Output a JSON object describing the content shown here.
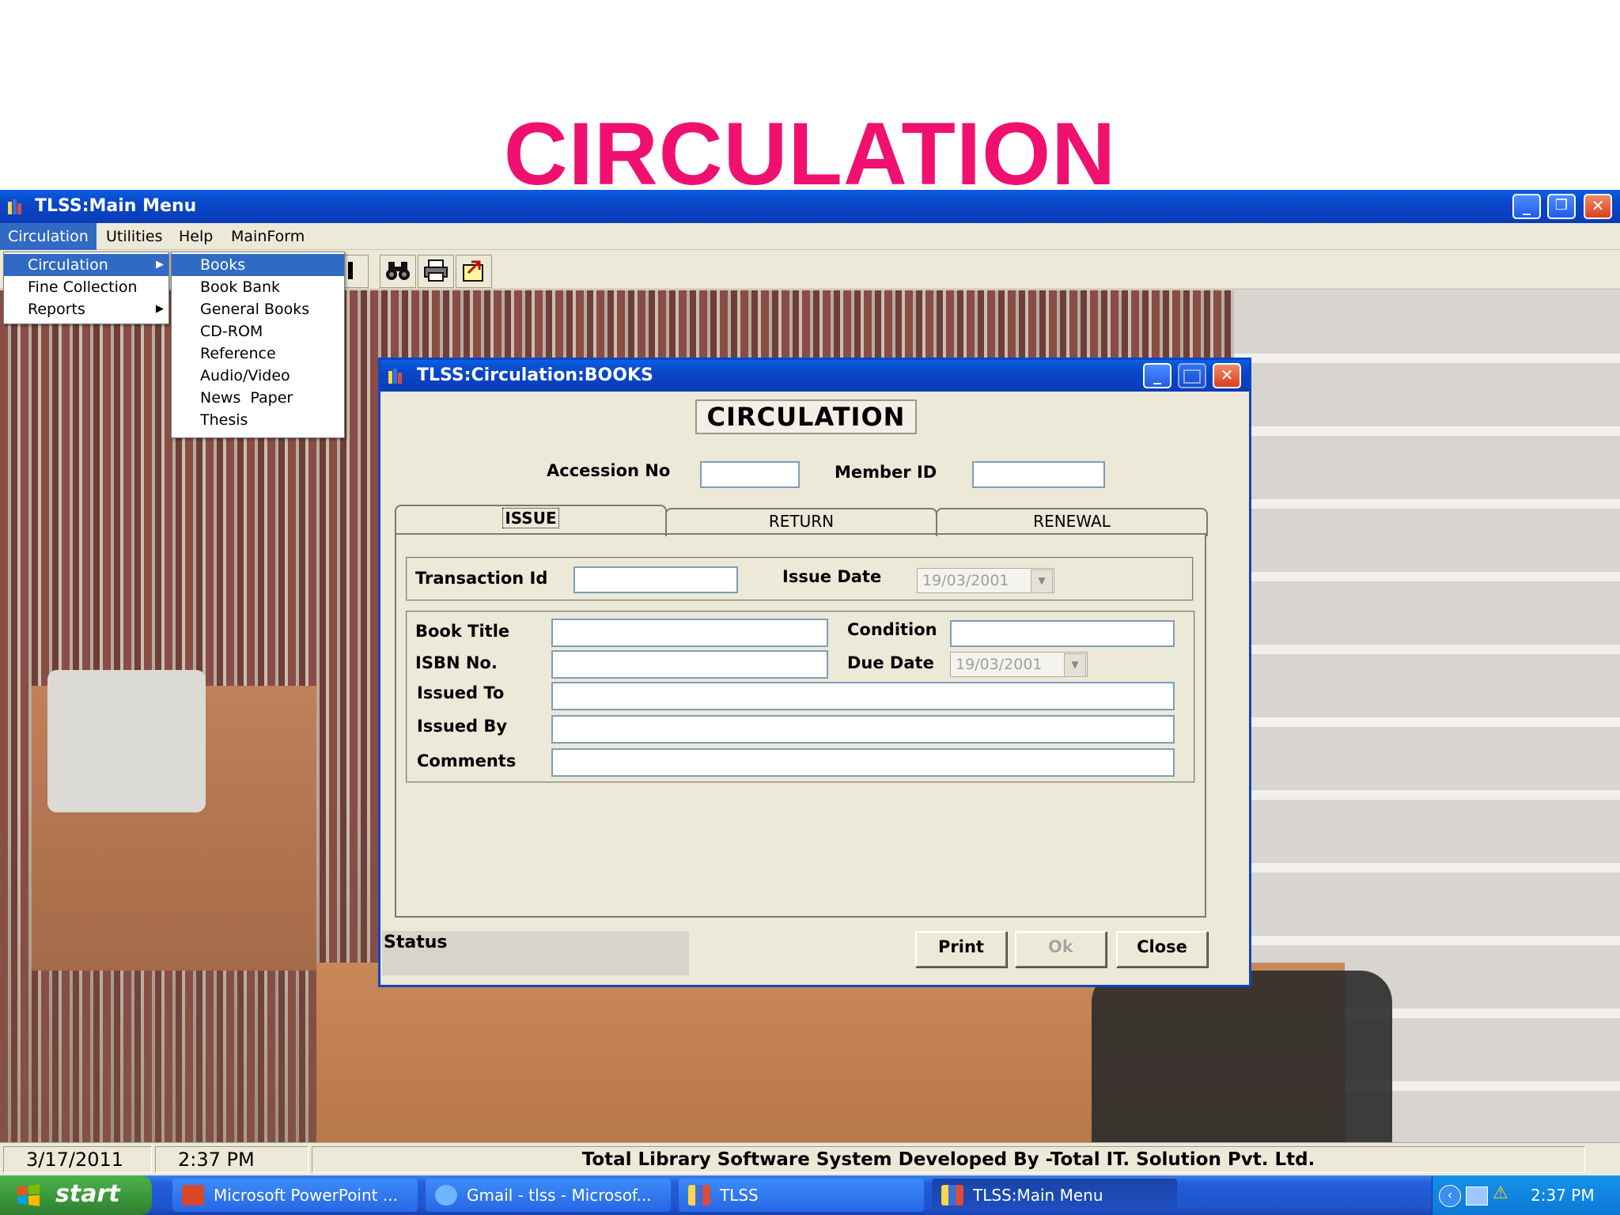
{
  "slide": {
    "title": "CIRCULATION"
  },
  "main_window": {
    "title": "TLSS:Main Menu",
    "controls": {
      "minimize": "_",
      "maximize": "❐",
      "close": "✕"
    }
  },
  "menubar": {
    "items": [
      "Circulation",
      "Utilities",
      "Help",
      "MainForm"
    ]
  },
  "circulation_menu": {
    "items": [
      "Circulation",
      "Fine Collection",
      "Reports"
    ],
    "submenu_marker": "▶"
  },
  "books_submenu": {
    "items": [
      "Books",
      "Book Bank",
      "General Books",
      "CD-ROM",
      "Reference",
      "Audio/Video",
      "News  Paper",
      "Thesis"
    ]
  },
  "toolbar": {
    "icons": [
      "binoculars-icon",
      "printer-icon",
      "export-icon"
    ]
  },
  "child_window": {
    "title": "TLSS:Circulation:BOOKS",
    "heading": "CIRCULATION",
    "accession_label": "Accession No",
    "accession_value": "",
    "member_label": "Member ID",
    "member_value": "",
    "tabs": [
      "ISSUE",
      "RETURN",
      "RENEWAL"
    ],
    "active_tab": "ISSUE",
    "issue": {
      "transaction_label": "Transaction Id",
      "transaction_value": "",
      "issue_date_label": "Issue Date",
      "issue_date_value": "19/03/2001",
      "book_title_label": "Book Title",
      "condition_label": "Condition",
      "isbn_label": "ISBN No.",
      "due_date_label": "Due Date",
      "due_date_value": "19/03/2001",
      "issued_to_label": "Issued To",
      "issued_by_label": "Issued By",
      "comments_label": "Comments"
    },
    "status_label": "Status",
    "buttons": {
      "print": "Print",
      "ok": "Ok",
      "close": "Close"
    }
  },
  "statusbar": {
    "date": "3/17/2011",
    "time": "2:37 PM",
    "message": "Total Library Software System Developed By -Total  IT. Solution Pvt. Ltd."
  },
  "taskbar": {
    "start": "start",
    "tasks": [
      "Microsoft PowerPoint ...",
      "Gmail - tlss - Microsof...",
      "TLSS",
      "TLSS:Main Menu"
    ],
    "clock": "2:37 PM"
  },
  "colors": {
    "title_pink": "#f0106f",
    "xp_blue": "#0a46c8",
    "menu_highlight": "#316ac5",
    "start_green": "#3c9a3c"
  }
}
